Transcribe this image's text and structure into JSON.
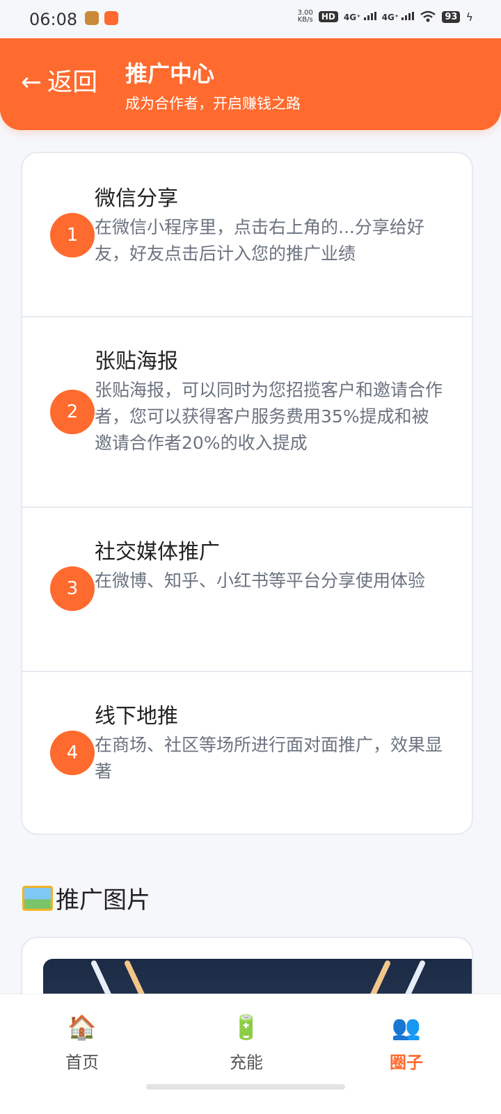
{
  "status_bar": {
    "time": "06:08",
    "net_speed_top": "3.00",
    "net_speed_unit": "KB/s",
    "hd_label": "HD",
    "sim1": "4G⁺",
    "sim2": "4G⁺",
    "battery": "93"
  },
  "header": {
    "back_label": "返回",
    "title": "推广中心",
    "subtitle": "成为合作者，开启赚钱之路"
  },
  "steps": [
    {
      "num": "1",
      "title": "微信分享",
      "desc": "在微信小程序里，点击右上角的...分享给好友，好友点击后计入您的推广业绩"
    },
    {
      "num": "2",
      "title": "张贴海报",
      "desc": "张贴海报，可以同时为您招揽客户和邀请合作者，您可以获得客户服务费用35%提成和被邀请合作者20%的收入提成"
    },
    {
      "num": "3",
      "title": "社交媒体推广",
      "desc": "在微博、知乎、小红书等平台分享使用体验"
    },
    {
      "num": "4",
      "title": "线下地推",
      "desc": "在商场、社区等场所进行面对面推广，效果显著"
    }
  ],
  "section": {
    "title": "推广图片",
    "icon": "framed-picture-icon"
  },
  "tabbar": {
    "items": [
      {
        "label": "首页",
        "icon": "house-icon"
      },
      {
        "label": "充能",
        "icon": "battery-icon"
      },
      {
        "label": "圈子",
        "icon": "people-icon",
        "active": true
      }
    ]
  },
  "colors": {
    "accent": "#ff6a2e",
    "background": "#f6f7fb",
    "text_primary": "#222222",
    "text_secondary": "#6b7380"
  }
}
